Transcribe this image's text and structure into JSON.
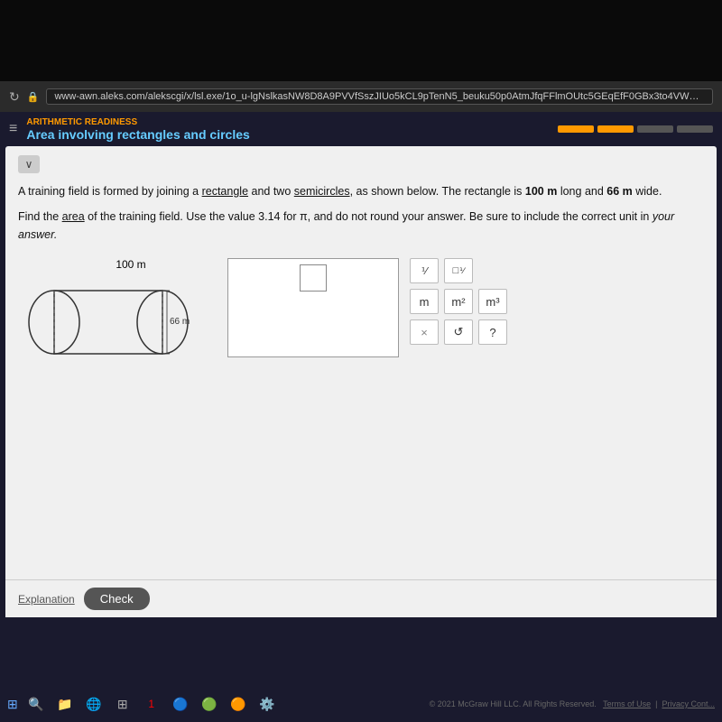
{
  "browser": {
    "url": "www-awn.aleks.com/alekscgi/x/lsl.exe/1o_u-lgNslkasNW8D8A9PVVfSszJIUo5kCL9pTenN5_beuku50p0AtmJfqFFlmOUtc5GEqEfF0GBx3to4VWPOJjT064AOXecGfVP_9OugkIs73...",
    "lock_icon": "🔒"
  },
  "navbar": {
    "subtitle": "ARITHMETIC READINESS",
    "title": "Area involving rectangles and circles"
  },
  "problem": {
    "text1": "A training field is formed by joining a rectangle and two semicircles, as shown below. The rectangle is 100 m long and 66 m wide.",
    "text2": "Find the area of the training field. Use the value 3.14 for π, and do not round your answer. Be sure to include the correct unit in your answer.",
    "rectangle_label": "100 m",
    "width_label": "66 m"
  },
  "symbols": {
    "fraction": "⅟",
    "mixed": "□⅟",
    "m_label": "m",
    "m2_label": "m²",
    "m3_label": "m³",
    "delete": "×",
    "undo": "↺",
    "help": "?"
  },
  "buttons": {
    "explanation": "Explanation",
    "check": "Check"
  },
  "taskbar": {
    "copyright": "© 2021 McGraw Hill LLC. All Rights Reserved.",
    "terms": "Terms of Use",
    "privacy": "Privacy Cont..."
  }
}
